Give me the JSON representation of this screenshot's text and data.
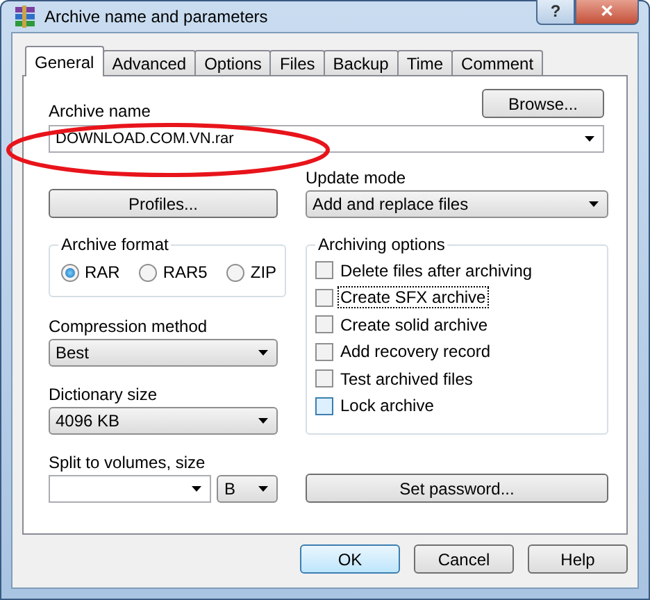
{
  "window": {
    "title": "Archive name and parameters",
    "help_button": "?",
    "close_button": "✕"
  },
  "tabs": [
    {
      "label": "General",
      "selected": true
    },
    {
      "label": "Advanced",
      "selected": false
    },
    {
      "label": "Options",
      "selected": false
    },
    {
      "label": "Files",
      "selected": false
    },
    {
      "label": "Backup",
      "selected": false
    },
    {
      "label": "Time",
      "selected": false
    },
    {
      "label": "Comment",
      "selected": false
    }
  ],
  "archive_name": {
    "label": "Archive name",
    "value": "DOWNLOAD.COM.VN.rar",
    "browse_button": "Browse..."
  },
  "profiles_button": "Profiles...",
  "update_mode": {
    "label": "Update mode",
    "value": "Add and replace files"
  },
  "archive_format": {
    "title": "Archive format",
    "options": [
      {
        "label": "RAR",
        "selected": true
      },
      {
        "label": "RAR5",
        "selected": false
      },
      {
        "label": "ZIP",
        "selected": false
      }
    ]
  },
  "compression_method": {
    "label": "Compression method",
    "value": "Best"
  },
  "dictionary_size": {
    "label": "Dictionary size",
    "value": "4096 KB"
  },
  "split_volumes": {
    "label": "Split to volumes, size",
    "unit": "B"
  },
  "archiving_options": {
    "title": "Archiving options",
    "items": [
      {
        "label": "Delete files after archiving",
        "checked": false,
        "focused": false,
        "hovered": false
      },
      {
        "label": "Create SFX archive",
        "checked": false,
        "focused": true,
        "hovered": false
      },
      {
        "label": "Create solid archive",
        "checked": false,
        "focused": false,
        "hovered": false
      },
      {
        "label": "Add recovery record",
        "checked": false,
        "focused": false,
        "hovered": false
      },
      {
        "label": "Test archived files",
        "checked": false,
        "focused": false,
        "hovered": false
      },
      {
        "label": "Lock archive",
        "checked": false,
        "focused": false,
        "hovered": true
      }
    ]
  },
  "set_password_button": "Set password...",
  "buttons": [
    {
      "label": "OK",
      "default": true
    },
    {
      "label": "Cancel",
      "default": false
    },
    {
      "label": "Help",
      "default": false
    }
  ]
}
